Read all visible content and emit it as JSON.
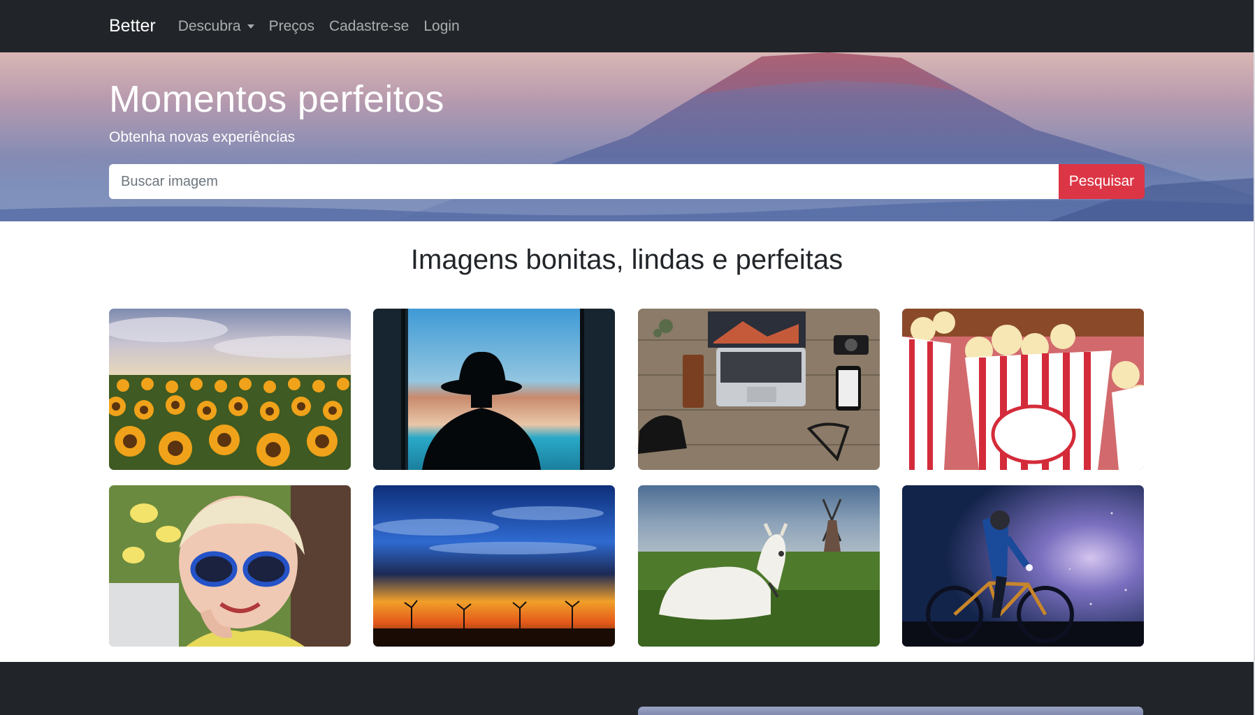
{
  "navbar": {
    "brand": "Better",
    "links": [
      {
        "label": "Descubra",
        "dropdown": true
      },
      {
        "label": "Preços"
      },
      {
        "label": "Cadastre-se"
      },
      {
        "label": "Login"
      }
    ]
  },
  "hero": {
    "title": "Momentos perfeitos",
    "subtitle": "Obtenha novas experiências",
    "search_placeholder": "Buscar imagem",
    "search_button": "Pesquisar"
  },
  "gallery": {
    "title": "Imagens bonitas, lindas e perfeitas",
    "images": [
      {
        "subject": "sunflower field"
      },
      {
        "subject": "silhouette with hat at window"
      },
      {
        "subject": "laptop on wooden desk"
      },
      {
        "subject": "popcorn boxes"
      },
      {
        "subject": "smiling woman with sunglasses"
      },
      {
        "subject": "sunset sky over wind turbines"
      },
      {
        "subject": "white goat with windmill"
      },
      {
        "subject": "cyclist at night"
      }
    ]
  },
  "colors": {
    "navbar_bg": "#212529",
    "accent_button": "#dc3545",
    "footer_bg": "#212529"
  }
}
